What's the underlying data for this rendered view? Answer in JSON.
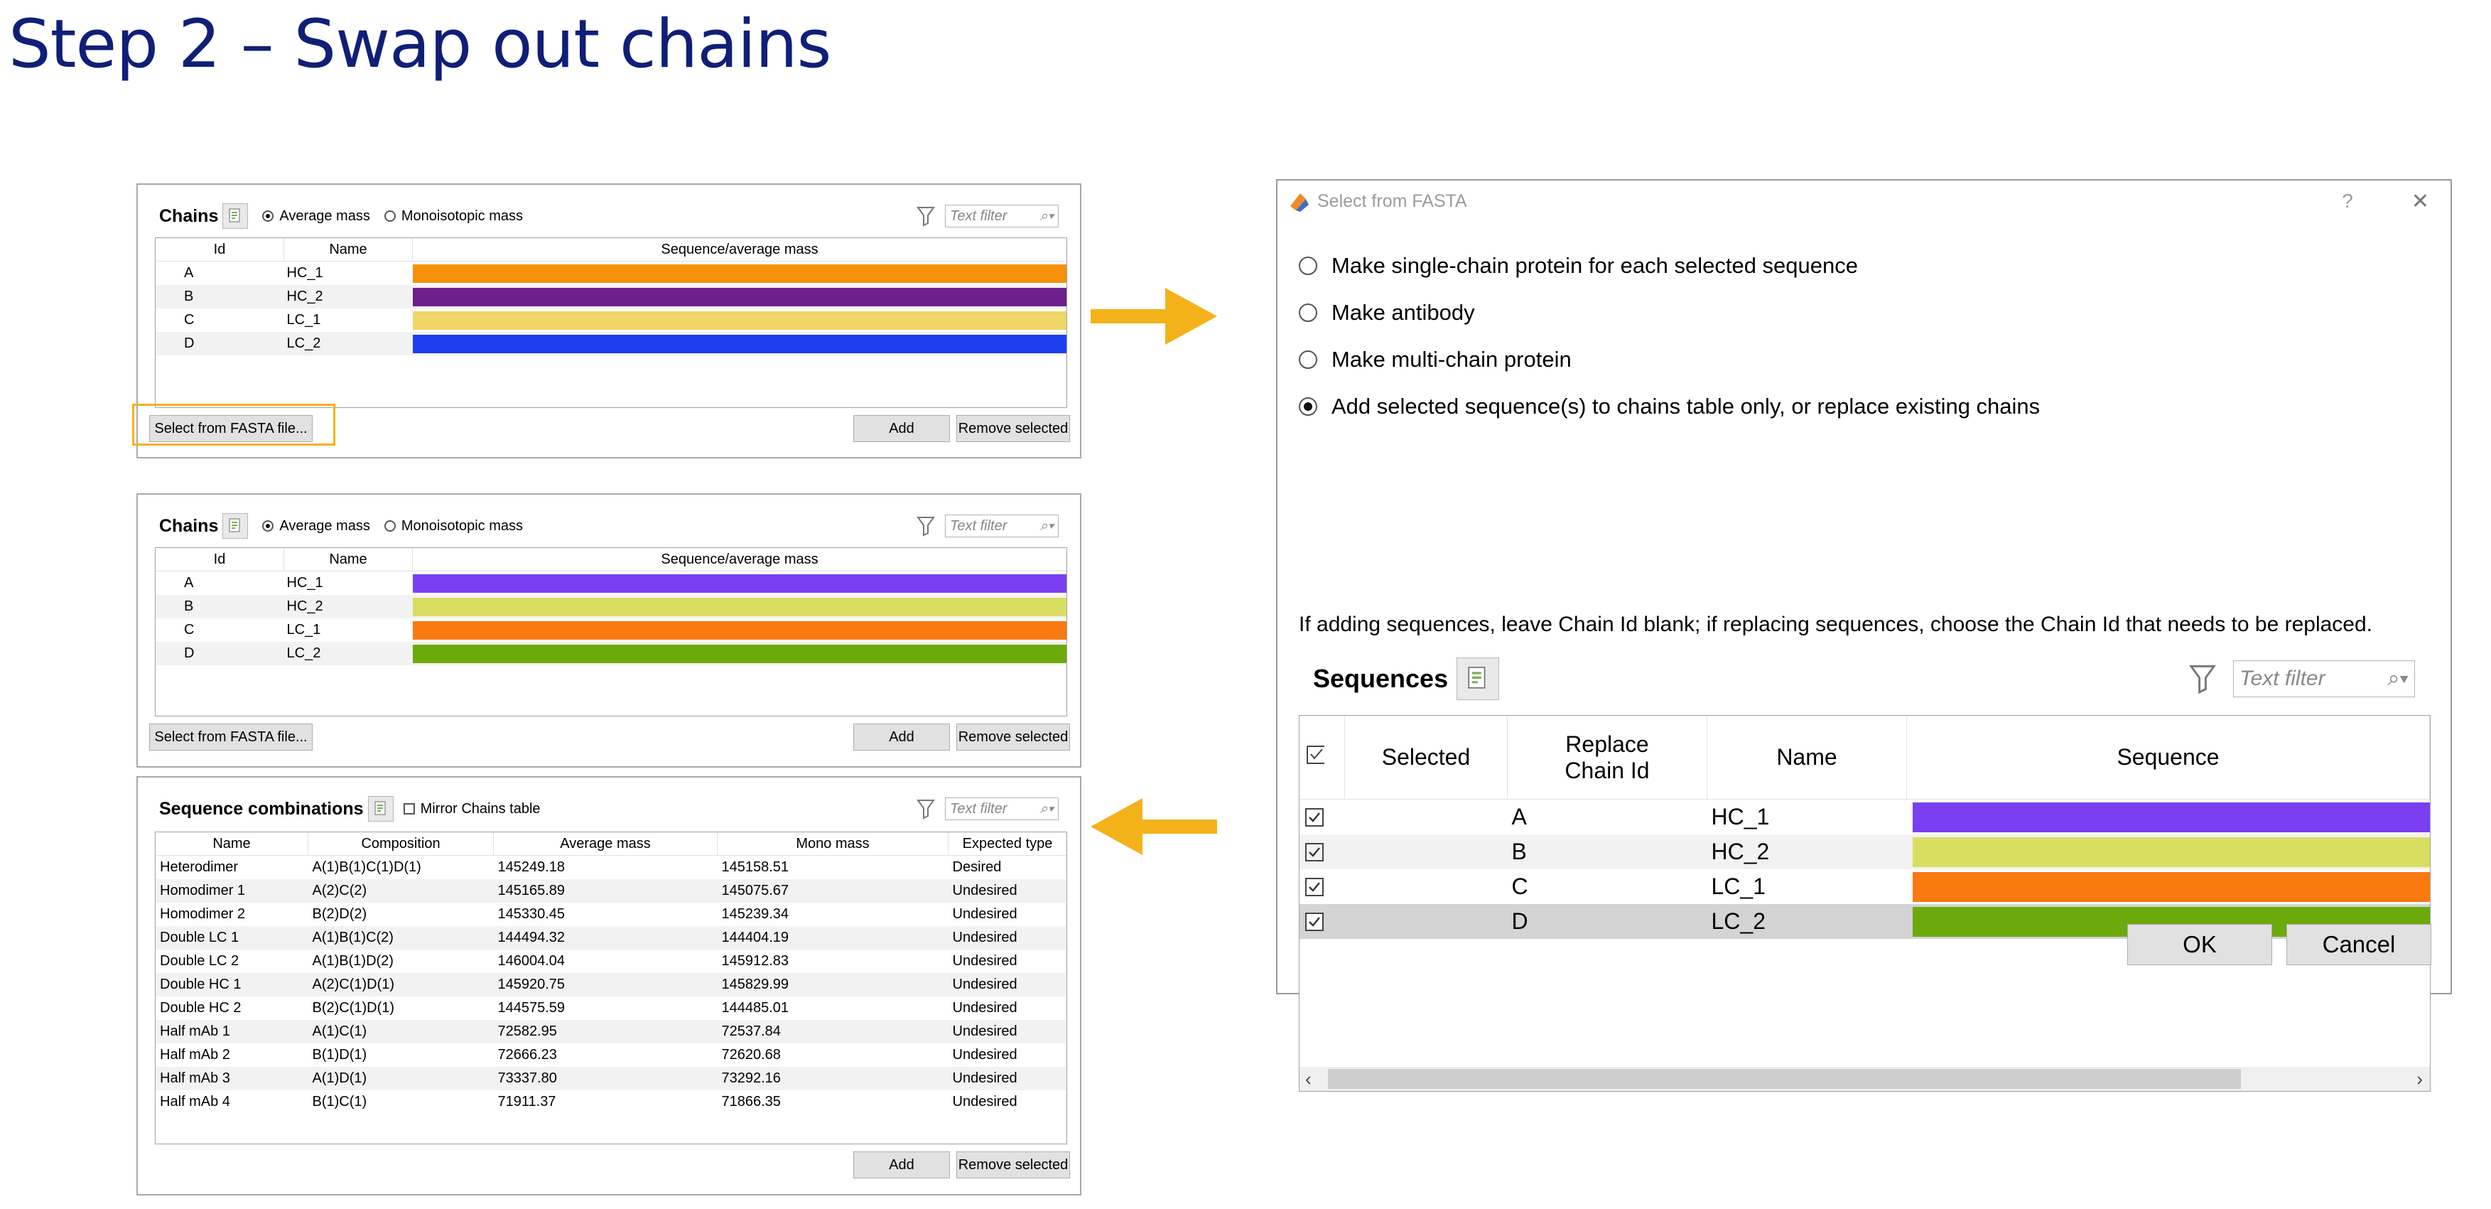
{
  "slide": {
    "title": "Step 2 – Swap out chains"
  },
  "colors": {
    "title": "#0f1f78",
    "arrow": "#f4b21a",
    "highlight": "#f4b21a"
  },
  "panel1": {
    "title": "Chains",
    "radio_avg": "Average mass",
    "radio_mono": "Monoisotopic mass",
    "filter_placeholder": "Text filter",
    "columns": [
      "Id",
      "Name",
      "Sequence/average mass"
    ],
    "rows": [
      {
        "id": "A",
        "name": "HC_1",
        "color": "#f7900b"
      },
      {
        "id": "B",
        "name": "HC_2",
        "color": "#6d1f8c"
      },
      {
        "id": "C",
        "name": "LC_1",
        "color": "#eed667"
      },
      {
        "id": "D",
        "name": "LC_2",
        "color": "#1c3ef0"
      }
    ],
    "btn_fasta": "Select from FASTA file...",
    "btn_add": "Add",
    "btn_remove": "Remove selected"
  },
  "panel2": {
    "title": "Chains",
    "radio_avg": "Average mass",
    "radio_mono": "Monoisotopic mass",
    "filter_placeholder": "Text filter",
    "columns": [
      "Id",
      "Name",
      "Sequence/average mass"
    ],
    "rows": [
      {
        "id": "A",
        "name": "HC_1",
        "color": "#7a3ff0"
      },
      {
        "id": "B",
        "name": "HC_2",
        "color": "#d9de60"
      },
      {
        "id": "C",
        "name": "LC_1",
        "color": "#f97a10"
      },
      {
        "id": "D",
        "name": "LC_2",
        "color": "#6caa0b"
      }
    ],
    "btn_fasta": "Select from FASTA file...",
    "btn_add": "Add",
    "btn_remove": "Remove selected"
  },
  "panel3": {
    "title": "Sequence combinations",
    "mirror_label": "Mirror Chains table",
    "filter_placeholder": "Text filter",
    "columns": [
      "Name",
      "Composition",
      "Average mass",
      "Mono mass",
      "Expected type"
    ],
    "rows": [
      [
        "Heterodimer",
        "A(1)B(1)C(1)D(1)",
        "145249.18",
        "145158.51",
        "Desired"
      ],
      [
        "Homodimer 1",
        "A(2)C(2)",
        "145165.89",
        "145075.67",
        "Undesired"
      ],
      [
        "Homodimer 2",
        "B(2)D(2)",
        "145330.45",
        "145239.34",
        "Undesired"
      ],
      [
        "Double LC 1",
        "A(1)B(1)C(2)",
        "144494.32",
        "144404.19",
        "Undesired"
      ],
      [
        "Double LC 2",
        "A(1)B(1)D(2)",
        "146004.04",
        "145912.83",
        "Undesired"
      ],
      [
        "Double HC 1",
        "A(2)C(1)D(1)",
        "145920.75",
        "145829.99",
        "Undesired"
      ],
      [
        "Double HC 2",
        "B(2)C(1)D(1)",
        "144575.59",
        "144485.01",
        "Undesired"
      ],
      [
        "Half mAb 1",
        "A(1)C(1)",
        "72582.95",
        "72537.84",
        "Undesired"
      ],
      [
        "Half mAb 2",
        "B(1)D(1)",
        "72666.23",
        "72620.68",
        "Undesired"
      ],
      [
        "Half mAb 3",
        "A(1)D(1)",
        "73337.80",
        "73292.16",
        "Undesired"
      ],
      [
        "Half mAb 4",
        "B(1)C(1)",
        "71911.37",
        "71866.35",
        "Undesired"
      ]
    ],
    "btn_add": "Add",
    "btn_remove": "Remove selected"
  },
  "dialog": {
    "title": "Select from FASTA",
    "help": "?",
    "close": "✕",
    "options": [
      {
        "label": "Make single-chain protein for each selected sequence",
        "selected": false
      },
      {
        "label": "Make antibody",
        "selected": false
      },
      {
        "label": "Make multi-chain protein",
        "selected": false
      },
      {
        "label": "Add selected sequence(s) to chains table only, or replace existing chains",
        "selected": true
      }
    ],
    "note": "If adding sequences, leave Chain Id blank; if replacing sequences, choose the Chain Id that needs to be replaced.",
    "seq_title": "Sequences",
    "filter_placeholder": "Text filter",
    "columns": {
      "selected": "Selected",
      "replace_line1": "Replace",
      "replace_line2": "Chain Id",
      "name": "Name",
      "sequence": "Sequence"
    },
    "rows": [
      {
        "replace": "A",
        "name": "HC_1",
        "color": "#7a3ff0"
      },
      {
        "replace": "B",
        "name": "HC_2",
        "color": "#d9de60"
      },
      {
        "replace": "C",
        "name": "LC_1",
        "color": "#f97a10"
      },
      {
        "replace": "D",
        "name": "LC_2",
        "color": "#6caa0b"
      }
    ],
    "btn_ok": "OK",
    "btn_cancel": "Cancel"
  }
}
